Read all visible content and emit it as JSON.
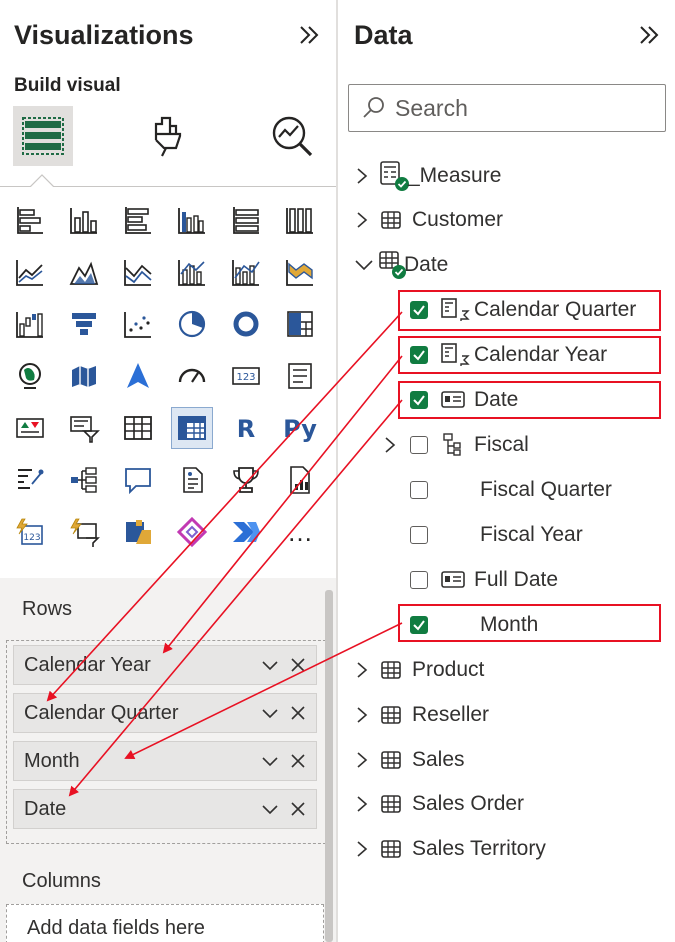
{
  "visualizations": {
    "title": "Visualizations",
    "build_visual_label": "Build visual",
    "build_tabs": [
      "build-visual",
      "format-visual",
      "analytics"
    ],
    "more_visuals": "…",
    "wells": {
      "rows_label": "Rows",
      "rows_fields": [
        "Calendar Year",
        "Calendar Quarter",
        "Month",
        "Date"
      ],
      "columns_label": "Columns",
      "columns_placeholder": "Add data fields here"
    }
  },
  "data": {
    "title": "Data",
    "search_placeholder": "Search",
    "tables": [
      {
        "name": "_Measure",
        "expanded": false,
        "icon": "measure-table-icon"
      },
      {
        "name": "Customer",
        "expanded": false,
        "icon": "table-icon"
      },
      {
        "name": "Date",
        "expanded": true,
        "icon": "table-icon",
        "fields": [
          {
            "name": "Calendar Quarter",
            "checked": true,
            "icon": "hierarchy-calendar-icon",
            "highlighted": true
          },
          {
            "name": "Calendar Year",
            "checked": true,
            "icon": "hierarchy-calendar-icon",
            "highlighted": true
          },
          {
            "name": "Date",
            "checked": true,
            "icon": "date-field-icon",
            "highlighted": true
          },
          {
            "name": "Fiscal",
            "checked": false,
            "icon": "hierarchy-icon",
            "expandable": true
          },
          {
            "name": "Fiscal Quarter",
            "checked": false
          },
          {
            "name": "Fiscal Year",
            "checked": false
          },
          {
            "name": "Full Date",
            "checked": false,
            "icon": "date-field-icon"
          },
          {
            "name": "Month",
            "checked": true,
            "highlighted": true
          }
        ]
      },
      {
        "name": "Product",
        "expanded": false,
        "icon": "table-icon"
      },
      {
        "name": "Reseller",
        "expanded": false,
        "icon": "table-icon"
      },
      {
        "name": "Sales",
        "expanded": false,
        "icon": "table-icon"
      },
      {
        "name": "Sales Order",
        "expanded": false,
        "icon": "table-icon"
      },
      {
        "name": "Sales Territory",
        "expanded": false,
        "icon": "table-icon"
      }
    ]
  },
  "colors": {
    "highlight": "#e81123",
    "checkbox_on": "#107c41",
    "accent_blue": "#2b579a"
  }
}
